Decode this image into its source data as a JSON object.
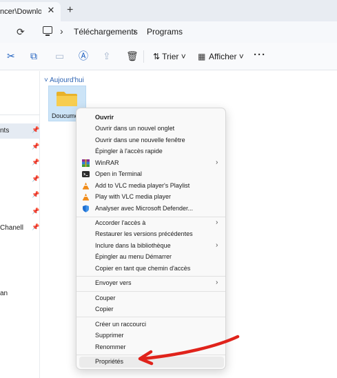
{
  "tab": {
    "title": "ncer\\Downloa",
    "close_glyph": "✕",
    "new_glyph": "+"
  },
  "address": {
    "refresh_glyph": "⟳",
    "chevron": "›",
    "crumbs": [
      "Téléchargements",
      "Programs"
    ]
  },
  "toolbar": {
    "cut_glyph": "✂",
    "copy_glyph": "⧉",
    "paste_glyph": "▭",
    "rename_glyph": "Ⓐ",
    "share_glyph": "⇪",
    "delete_glyph": "🗑",
    "sort_label": "⇅  Trier  ˅",
    "view_label": "Afficher  ˅",
    "view_glyph": "▦",
    "more_glyph": "···"
  },
  "nav": {
    "pin_glyph": "📌",
    "items": [
      {
        "label": "nts",
        "pinned": true,
        "selected": true
      },
      {
        "label": "",
        "pinned": true
      },
      {
        "label": "",
        "pinned": true
      },
      {
        "label": "",
        "pinned": true
      },
      {
        "label": "",
        "pinned": true
      },
      {
        "label": "",
        "pinned": true
      },
      {
        "label": "Chanell",
        "pinned": true
      },
      {
        "label": "an",
        "pinned": false
      }
    ]
  },
  "content": {
    "group_header": "˅ Aujourd'hui",
    "folder_label": "Doucume"
  },
  "context_menu": {
    "groups": [
      [
        {
          "label": "Ouvrir",
          "bold": true
        },
        {
          "label": "Ouvrir dans un nouvel onglet"
        },
        {
          "label": "Ouvrir dans une nouvelle fenêtre"
        },
        {
          "label": "Épingler à l'accès rapide"
        },
        {
          "label": "WinRAR",
          "icon": "winrar-icon",
          "submenu": true
        },
        {
          "label": "Open in Terminal",
          "icon": "terminal-icon"
        },
        {
          "label": "Add to VLC media player's Playlist",
          "icon": "vlc-icon"
        },
        {
          "label": "Play with VLC media player",
          "icon": "vlc-icon"
        },
        {
          "label": "Analyser avec Microsoft Defender...",
          "icon": "defender-icon"
        }
      ],
      [
        {
          "label": "Accorder l'accès à",
          "submenu": true
        },
        {
          "label": "Restaurer les versions précédentes"
        },
        {
          "label": "Inclure dans la bibliothèque",
          "submenu": true
        },
        {
          "label": "Épingler au menu Démarrer"
        },
        {
          "label": "Copier en tant que chemin d'accès"
        }
      ],
      [
        {
          "label": "Envoyer vers",
          "submenu": true
        }
      ],
      [
        {
          "label": "Couper"
        },
        {
          "label": "Copier"
        }
      ],
      [
        {
          "label": "Créer un raccourci"
        },
        {
          "label": "Supprimer"
        },
        {
          "label": "Renommer"
        }
      ],
      [
        {
          "label": "Propriétés",
          "highlighted": true
        }
      ]
    ],
    "submenu_glyph": "›"
  },
  "colors": {
    "accent": "#1d5fbf",
    "annotation_arrow": "#e0231b",
    "folder": "#f4c542",
    "selection": "#cce4f7"
  }
}
